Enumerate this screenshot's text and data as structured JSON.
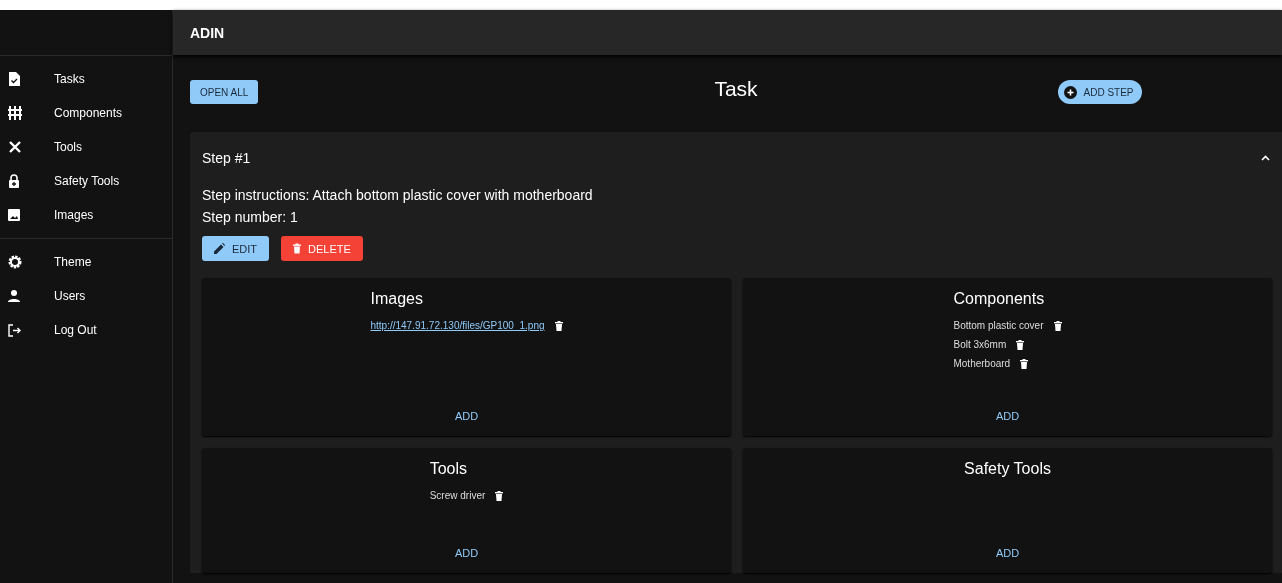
{
  "app_bar": {
    "title": "ADIN"
  },
  "sidebar": {
    "groups": [
      {
        "items": [
          {
            "label": "Tasks"
          },
          {
            "label": "Components"
          },
          {
            "label": "Tools"
          },
          {
            "label": "Safety Tools"
          },
          {
            "label": "Images"
          }
        ]
      },
      {
        "items": [
          {
            "label": "Theme"
          },
          {
            "label": "Users"
          },
          {
            "label": "Log Out"
          }
        ]
      }
    ]
  },
  "toolbar": {
    "open_all": "OPEN ALL",
    "title": "Task",
    "add_step": "ADD STEP"
  },
  "steps": [
    {
      "title": "Step #1",
      "expanded": true,
      "instructions": "Step instructions: Attach bottom plastic cover with motherboard",
      "number": "Step number: 1",
      "edit": "EDIT",
      "delete": "DELETE",
      "cards": [
        {
          "title": "Images",
          "add": "ADD",
          "items": [
            {
              "kind": "link",
              "text": "http://147.91.72.130/files/GP100_1.png"
            }
          ]
        },
        {
          "title": "Components",
          "add": "ADD",
          "items": [
            {
              "kind": "text",
              "text": "Bottom plastic cover"
            },
            {
              "kind": "text",
              "text": "Bolt 3x6mm"
            },
            {
              "kind": "text",
              "text": "Motherboard"
            }
          ]
        },
        {
          "title": "Tools",
          "add": "ADD",
          "items": [
            {
              "kind": "text",
              "text": "Screw driver"
            }
          ]
        },
        {
          "title": "Safety Tools",
          "add": "ADD"
        }
      ]
    }
  ]
}
